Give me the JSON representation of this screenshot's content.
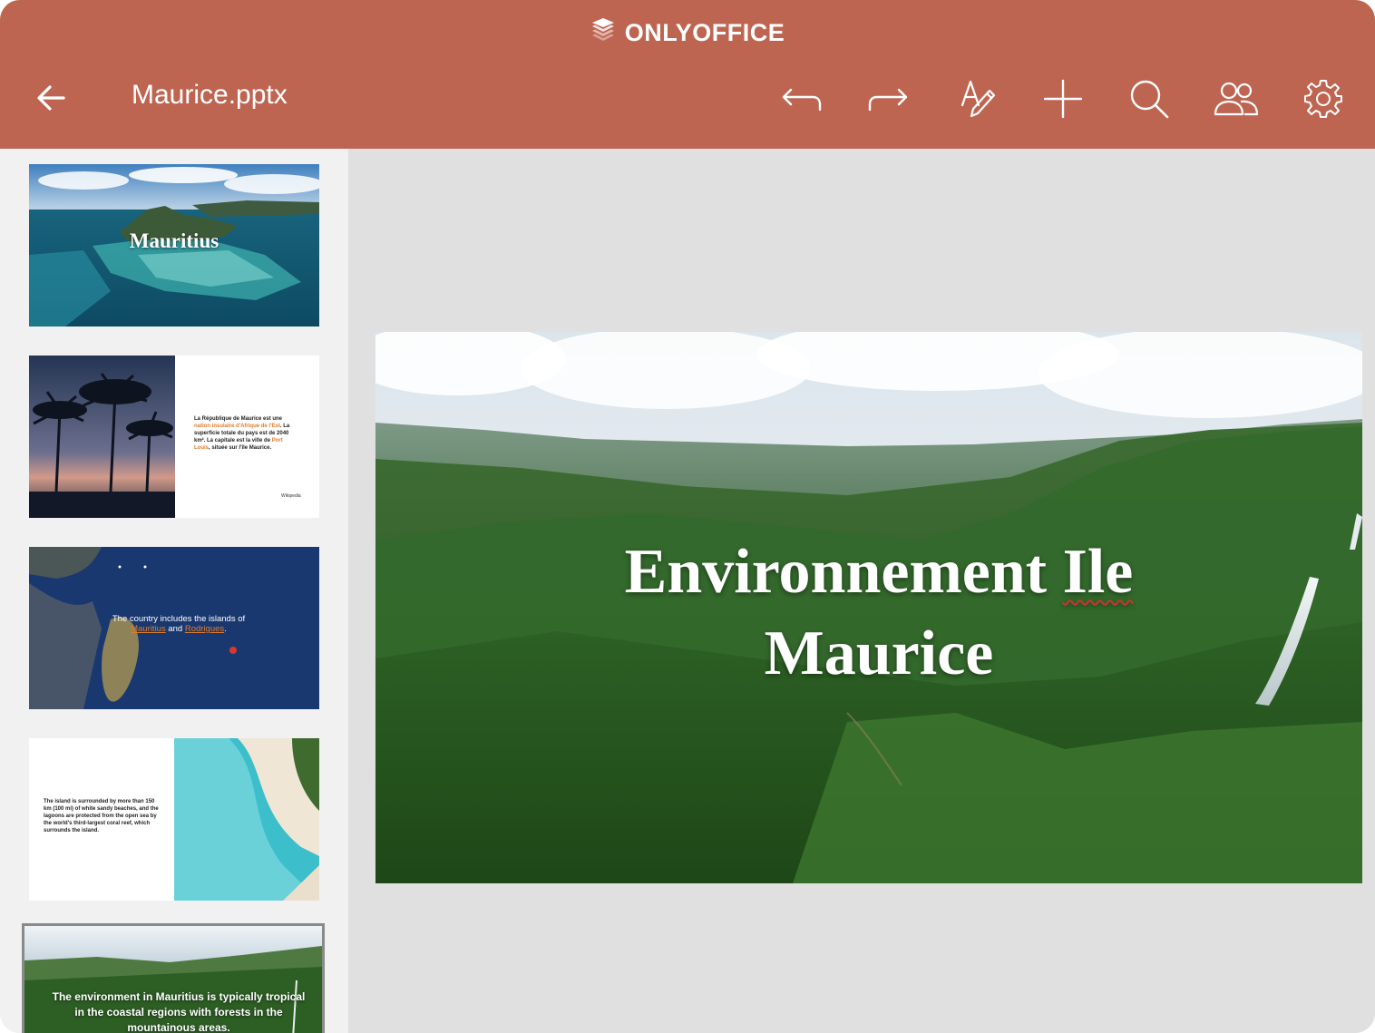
{
  "app": {
    "brand": "ONLYOFFICE",
    "document_title": "Maurice.pptx",
    "accent_color": "#be6552"
  },
  "toolbar": {
    "buttons": [
      {
        "name": "undo-button",
        "icon": "undo-icon"
      },
      {
        "name": "redo-button",
        "icon": "redo-icon"
      },
      {
        "name": "format-button",
        "icon": "text-edit-icon"
      },
      {
        "name": "add-button",
        "icon": "plus-icon"
      },
      {
        "name": "search-button",
        "icon": "search-icon"
      },
      {
        "name": "collaboration-button",
        "icon": "users-icon"
      },
      {
        "name": "settings-button",
        "icon": "gear-icon"
      }
    ]
  },
  "thumbnails": [
    {
      "title": "Mauritius"
    },
    {
      "text_parts": [
        "La République de Maurice est une ",
        "nation insulaire d'Afrique de l'Est",
        ". La superficie totale du pays est de 2040 km². La capitale est la ville de ",
        "Port Louis",
        ", située sur l'île Maurice."
      ],
      "footer": "Wikipedia"
    },
    {
      "text_parts": [
        "The country includes the islands of ",
        "Mauritius",
        " and ",
        "Rodrigues",
        "."
      ]
    },
    {
      "text": "The island is surrounded by more than 150 km (100 mi) of white sandy beaches, and the lagoons are protected from the open sea by the world's third-largest coral reef, which surrounds the island."
    },
    {
      "text": "The environment in Mauritius is typically tropical in the coastal regions with forests in the mountainous areas.",
      "selected": true
    }
  ],
  "slide": {
    "title_line1_a": "Environnement ",
    "title_line1_b": "Ile",
    "title_line2": "Maurice"
  }
}
